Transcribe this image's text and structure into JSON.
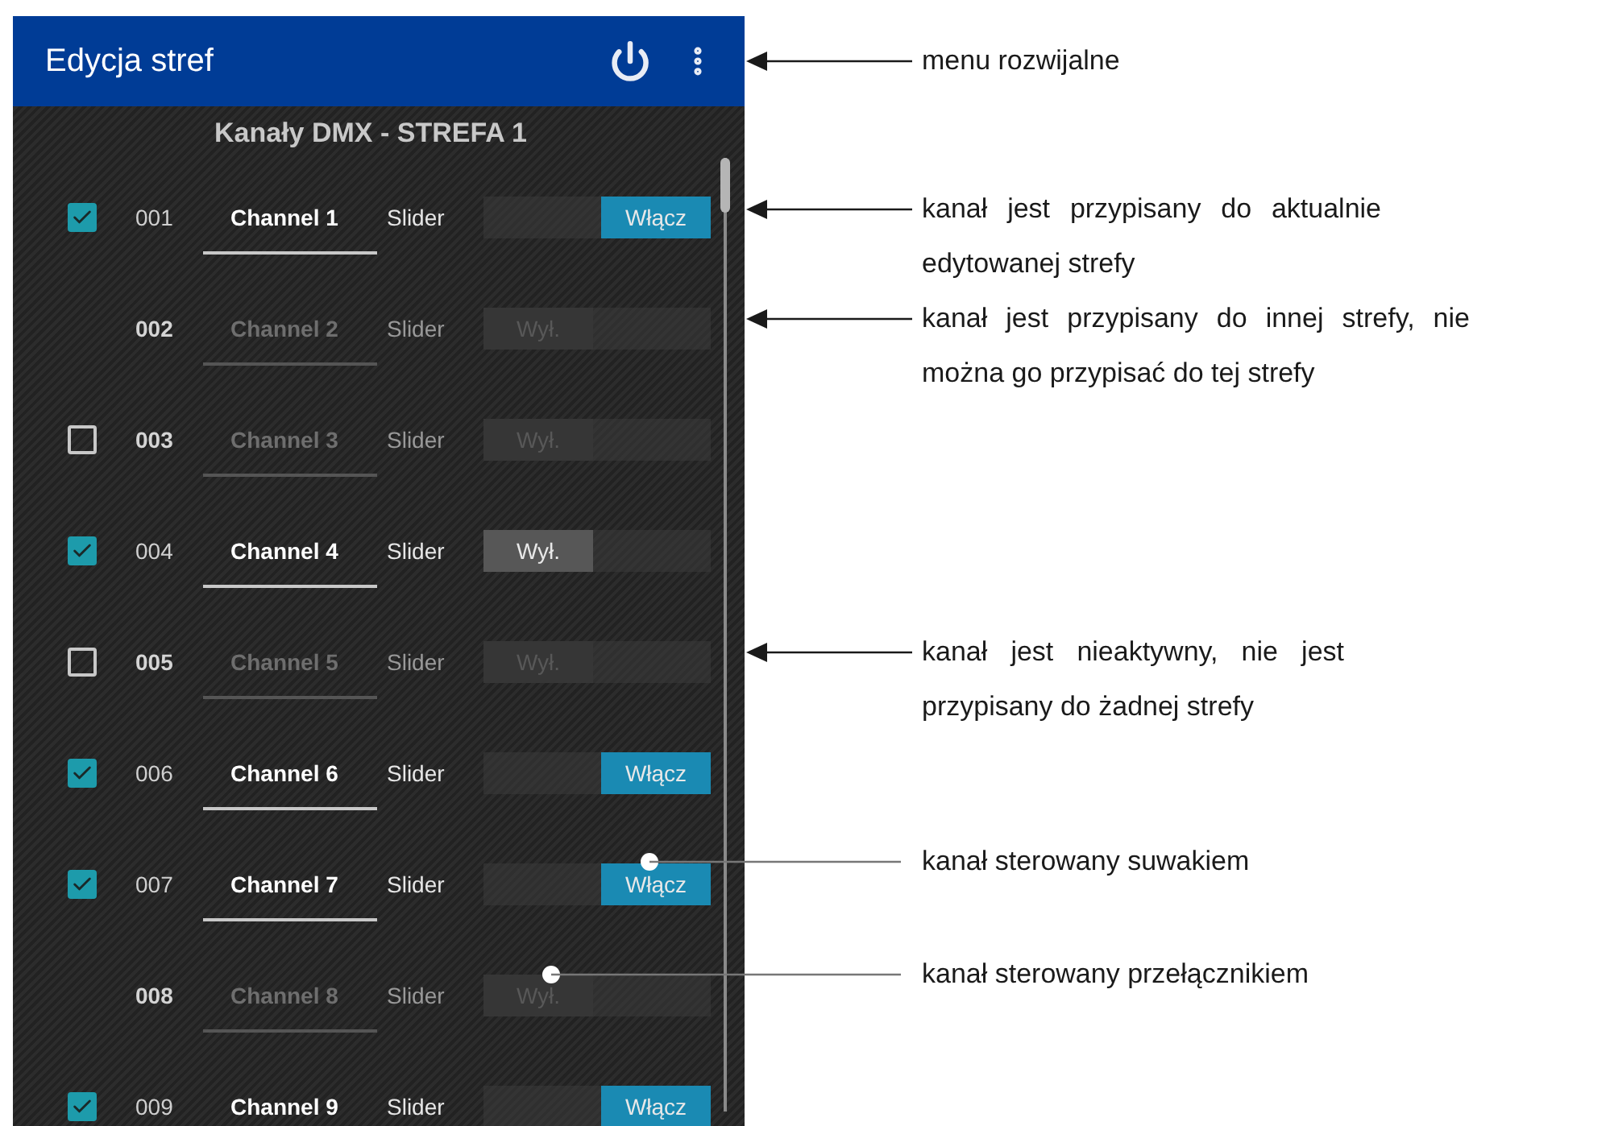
{
  "app_bar": {
    "title": "Edycja stref"
  },
  "list_title": "Kanały DMX - STREFA 1",
  "channels": [
    {
      "number": "001",
      "name": "Channel 1",
      "type": "Slider",
      "kind": "assigned",
      "on": true,
      "switch_label": "Włącz"
    },
    {
      "number": "002",
      "name": "Channel 2",
      "type": "Slider",
      "kind": "other_zone",
      "on": false,
      "switch_label": "Wył."
    },
    {
      "number": "003",
      "name": "Channel 3",
      "type": "Slider",
      "kind": "unassigned",
      "on": false,
      "switch_label": "Wył."
    },
    {
      "number": "004",
      "name": "Channel 4",
      "type": "Slider",
      "kind": "assigned",
      "on": false,
      "switch_label": "Wył."
    },
    {
      "number": "005",
      "name": "Channel 5",
      "type": "Slider",
      "kind": "unassigned",
      "on": false,
      "switch_label": "Wył."
    },
    {
      "number": "006",
      "name": "Channel 6",
      "type": "Slider",
      "kind": "assigned",
      "on": true,
      "switch_label": "Włącz"
    },
    {
      "number": "007",
      "name": "Channel 7",
      "type": "Slider",
      "kind": "assigned",
      "on": true,
      "switch_label": "Włącz"
    },
    {
      "number": "008",
      "name": "Channel 8",
      "type": "Slider",
      "kind": "other_zone",
      "on": false,
      "switch_label": "Wył."
    },
    {
      "number": "009",
      "name": "Channel 9",
      "type": "Slider",
      "kind": "assigned",
      "on": true,
      "switch_label": "Włącz"
    }
  ],
  "annotations": [
    {
      "kind": "arrow",
      "text": "menu rozwijalne"
    },
    {
      "kind": "arrow",
      "text": "kanał jest przypisany do aktualnie edytowanej strefy"
    },
    {
      "kind": "arrow",
      "text": "kanał jest przypisany do innej strefy, nie można go przypisać do tej strefy"
    },
    {
      "kind": "arrow",
      "text": "kanał jest nieaktywny, nie jest przypisany do żadnej strefy"
    },
    {
      "kind": "dot",
      "text": "kanał sterowany suwakiem"
    },
    {
      "kind": "dot",
      "text": "kanał sterowany przełącznikiem"
    }
  ]
}
